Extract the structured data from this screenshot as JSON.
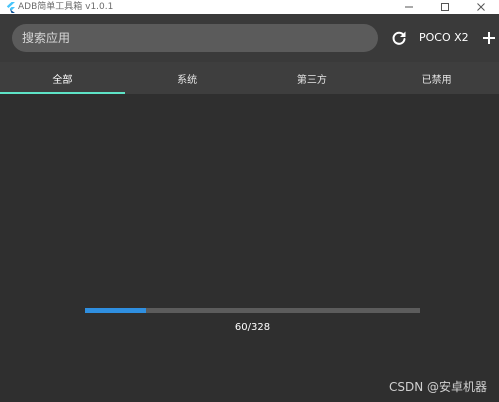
{
  "window": {
    "title": "ADB简单工具箱 v1.0.1",
    "icons": {
      "app": "flutter-logo-icon",
      "minimize": "minimize-icon",
      "maximize": "maximize-icon",
      "close": "close-icon"
    }
  },
  "toolbar": {
    "search_placeholder": "搜索应用",
    "search_value": "",
    "refresh_icon": "refresh-icon",
    "device_name": "POCO X2",
    "add_icon": "plus-icon"
  },
  "tabs": [
    {
      "label": "全部",
      "active": true
    },
    {
      "label": "系统",
      "active": false
    },
    {
      "label": "第三方",
      "active": false
    },
    {
      "label": "已禁用",
      "active": false
    }
  ],
  "progress": {
    "current": 60,
    "total": 328,
    "text": "60/328"
  },
  "watermark": "CSDN @安卓机器",
  "colors": {
    "background": "#2f2f2f",
    "toolbar": "#3a3a3a",
    "tabs": "#3e3e3e",
    "search": "#5b5b5b",
    "accent_tab": "#5ee3c7",
    "progress_fill": "#2f8fe0",
    "progress_track": "#5c5c5c"
  }
}
